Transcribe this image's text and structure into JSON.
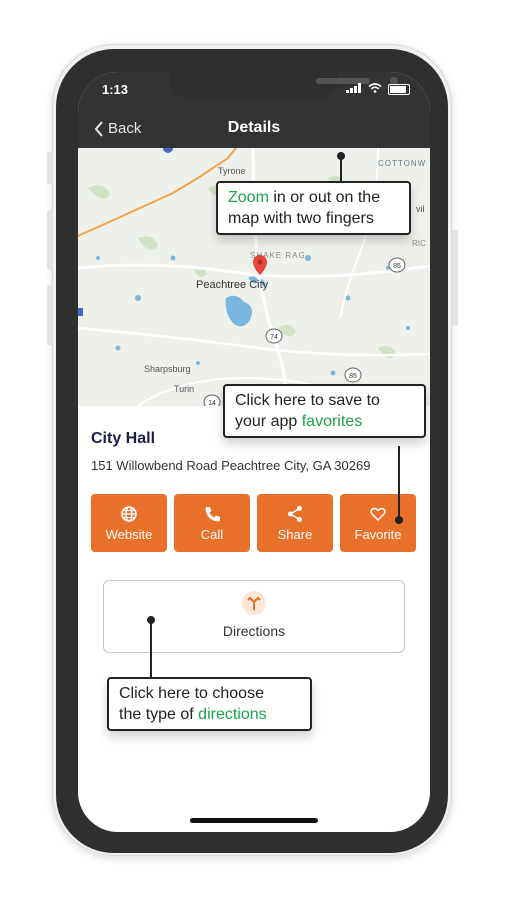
{
  "status_bar": {
    "time": "1:13"
  },
  "nav": {
    "back_label": "Back",
    "title": "Details"
  },
  "map": {
    "labels": {
      "tyrone": "Tyrone",
      "cottonwood": "COTTONW",
      "shake_rag": "SHAKE RAG",
      "peachtree_city": "Peachtree City",
      "sharpsburg": "Sharpsburg",
      "turin": "Turin",
      "road_85a": "85",
      "road_74": "74",
      "road_85b": "85",
      "road_14": "14",
      "edge_vil": "vil",
      "edge_ric": "RIC"
    }
  },
  "place": {
    "name": "City Hall",
    "address": "151 Willowbend Road Peachtree City, GA 30269"
  },
  "actions": [
    {
      "label": "Website",
      "icon": "globe-icon"
    },
    {
      "label": "Call",
      "icon": "phone-icon"
    },
    {
      "label": "Share",
      "icon": "share-icon"
    },
    {
      "label": "Favorite",
      "icon": "heart-icon"
    }
  ],
  "directions": {
    "label": "Directions",
    "icon": "directions-icon"
  },
  "callouts": {
    "zoom": {
      "highlight": "Zoom",
      "rest1": " in or out on the",
      "line2": "map with two fingers"
    },
    "favorites": {
      "line1": "Click here to save to",
      "line2_prefix": "your app ",
      "highlight": "favorites"
    },
    "directions": {
      "line1": "Click here to choose",
      "line2_prefix": "the type of ",
      "highlight": "directions"
    }
  },
  "colors": {
    "accent": "#e8702a",
    "highlight_green": "#1aa34a",
    "header": "#333333",
    "title_navy": "#1e1e4a"
  }
}
